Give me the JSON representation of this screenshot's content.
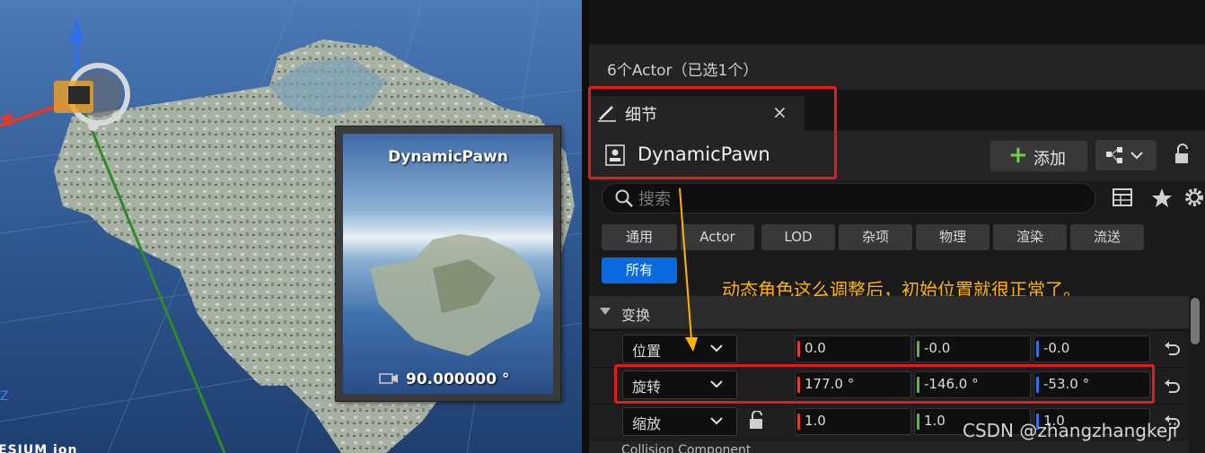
{
  "viewport": {
    "preview": {
      "title": "DynamicPawn",
      "readout": "90.000000 °"
    },
    "axis_z_label": "Z",
    "logo_text": "ESIUM ion"
  },
  "panel": {
    "selection_text": "6个Actor（已选1个）",
    "tab": {
      "label": "细节",
      "close": "×"
    },
    "actor_name": "DynamicPawn",
    "add_button": "添加",
    "search_placeholder": "搜索",
    "filters": [
      "通用",
      "Actor",
      "LOD",
      "杂项",
      "物理",
      "渲染",
      "流送",
      "所有"
    ],
    "active_filter": "所有",
    "annotation": "动态角色这么调整后，初始位置就很正常了。",
    "section": "变换",
    "rows": [
      {
        "label": "位置",
        "x": "0.0",
        "y": "-0.0",
        "z": "-0.0"
      },
      {
        "label": "旋转",
        "x": "177.0 °",
        "y": "-146.0 °",
        "z": "-53.0 °"
      },
      {
        "label": "缩放",
        "x": "1.0",
        "y": "1.0",
        "z": "1.0"
      }
    ],
    "collision_label": "Collision Component",
    "watermark": "CSDN @zhangzhangkeji"
  },
  "colors": {
    "axis_x": "#e03a2a",
    "axis_y": "#5fb83a",
    "axis_z": "#2f6fe8",
    "highlight": "#e41b1b",
    "annotation": "#ffb400",
    "active_filter": "#0a6be0"
  }
}
